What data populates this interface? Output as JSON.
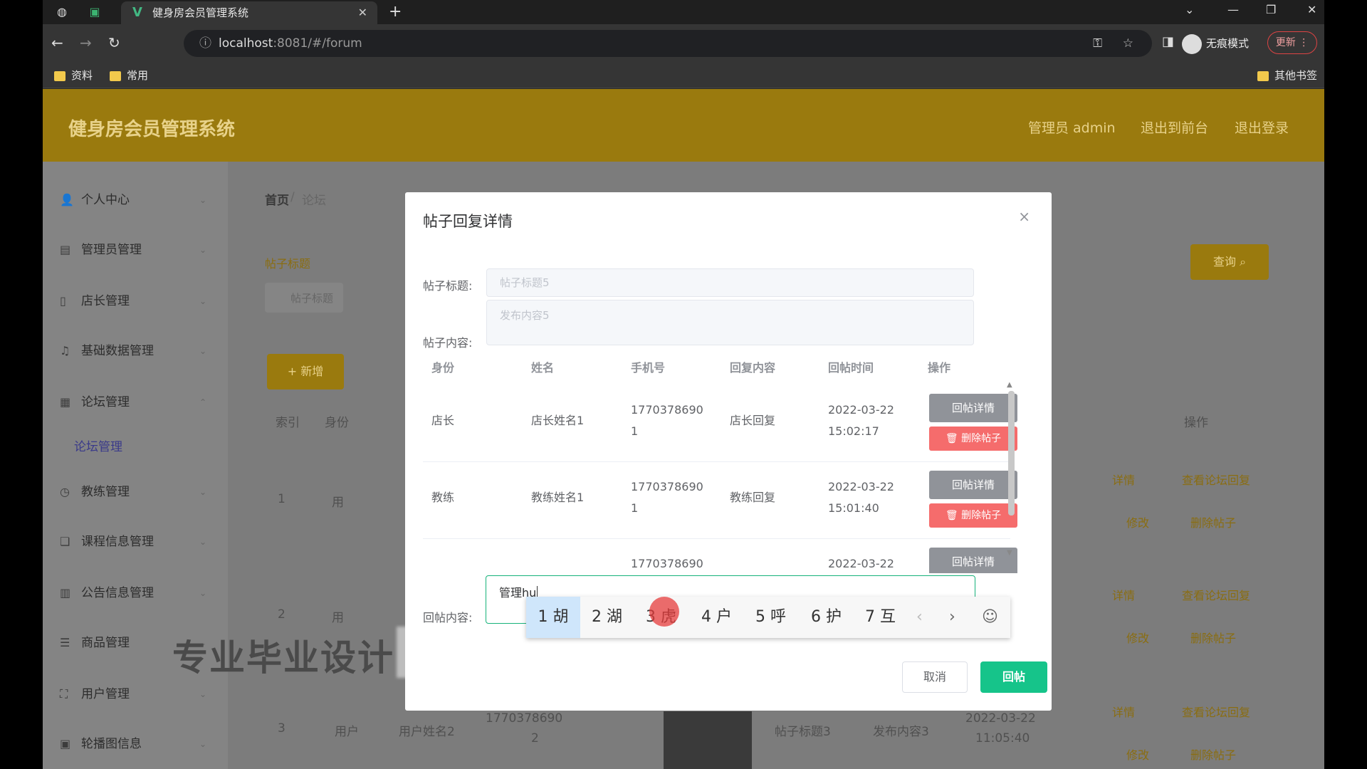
{
  "browser": {
    "tab_title": "健身房会员管理系统",
    "url_host": "localhost",
    "url_rest": ":8081/#/forum",
    "incognito_label": "无痕模式",
    "update_label": "更新",
    "bookmarks": [
      "资料",
      "常用"
    ],
    "other_bookmarks": "其他书签"
  },
  "app": {
    "title": "健身房会员管理系统",
    "header_links": [
      "管理员 admin",
      "退出到前台",
      "退出登录"
    ],
    "sidebar": {
      "items": [
        "个人中心",
        "管理员管理",
        "店长管理",
        "基础数据管理",
        "论坛管理",
        "教练管理",
        "课程信息管理",
        "公告信息管理",
        "商品管理",
        "用户管理",
        "轮播图信息"
      ],
      "active_sub": "论坛管理"
    },
    "breadcrumb": [
      "首页",
      "论坛"
    ],
    "filter_label": "帖子标题",
    "filter_placeholder": "帖子标题",
    "query_button": "查询",
    "add_button": "+ 新增",
    "bg_table": {
      "headers": [
        "索引",
        "身份",
        "操作"
      ],
      "rows": [
        {
          "index": "1",
          "identity": "用"
        },
        {
          "index": "2",
          "identity": "用"
        },
        {
          "index": "3",
          "identity": "用户",
          "name": "用户姓名2",
          "phone_1": "1770378690",
          "phone_2": "2",
          "title": "帖子标题3",
          "content": "发布内容3",
          "date": "2022-03-22",
          "time": "11:05:40"
        }
      ],
      "actions": [
        "详情",
        "查看论坛回复",
        "修改",
        "删除帖子"
      ]
    }
  },
  "watermark": "专业毕业设计",
  "dialog": {
    "title": "帖子回复详情",
    "close": "×",
    "label_title": "帖子标题:",
    "label_content": "帖子内容:",
    "label_reply": "回帖内容:",
    "title_value": "帖子标题5",
    "content_value": "发布内容5",
    "table": {
      "headers": [
        "身份",
        "姓名",
        "手机号",
        "回复内容",
        "回帖时间",
        "操作"
      ],
      "rows": [
        {
          "identity": "店长",
          "name": "店长姓名1",
          "phone_1": "1770378690",
          "phone_2": "1",
          "content": "店长回复",
          "date": "2022-03-22",
          "time": "15:02:17"
        },
        {
          "identity": "教练",
          "name": "教练姓名1",
          "phone_1": "1770378690",
          "phone_2": "1",
          "content": "教练回复",
          "date": "2022-03-22",
          "time": "15:01:40"
        },
        {
          "phone_1": "1770378690",
          "date": "2022-03-22"
        }
      ],
      "detail_button": "回帖详情",
      "delete_button": "删除帖子"
    },
    "reply_value": "管理hu",
    "cancel_button": "取消",
    "reply_button": "回帖"
  },
  "ime": {
    "candidates": [
      "1 胡",
      "2 湖",
      "3 虎",
      "4 户",
      "5 呼",
      "6 护",
      "7 互"
    ],
    "prev": "‹",
    "next": "›",
    "emoji": "☺"
  }
}
